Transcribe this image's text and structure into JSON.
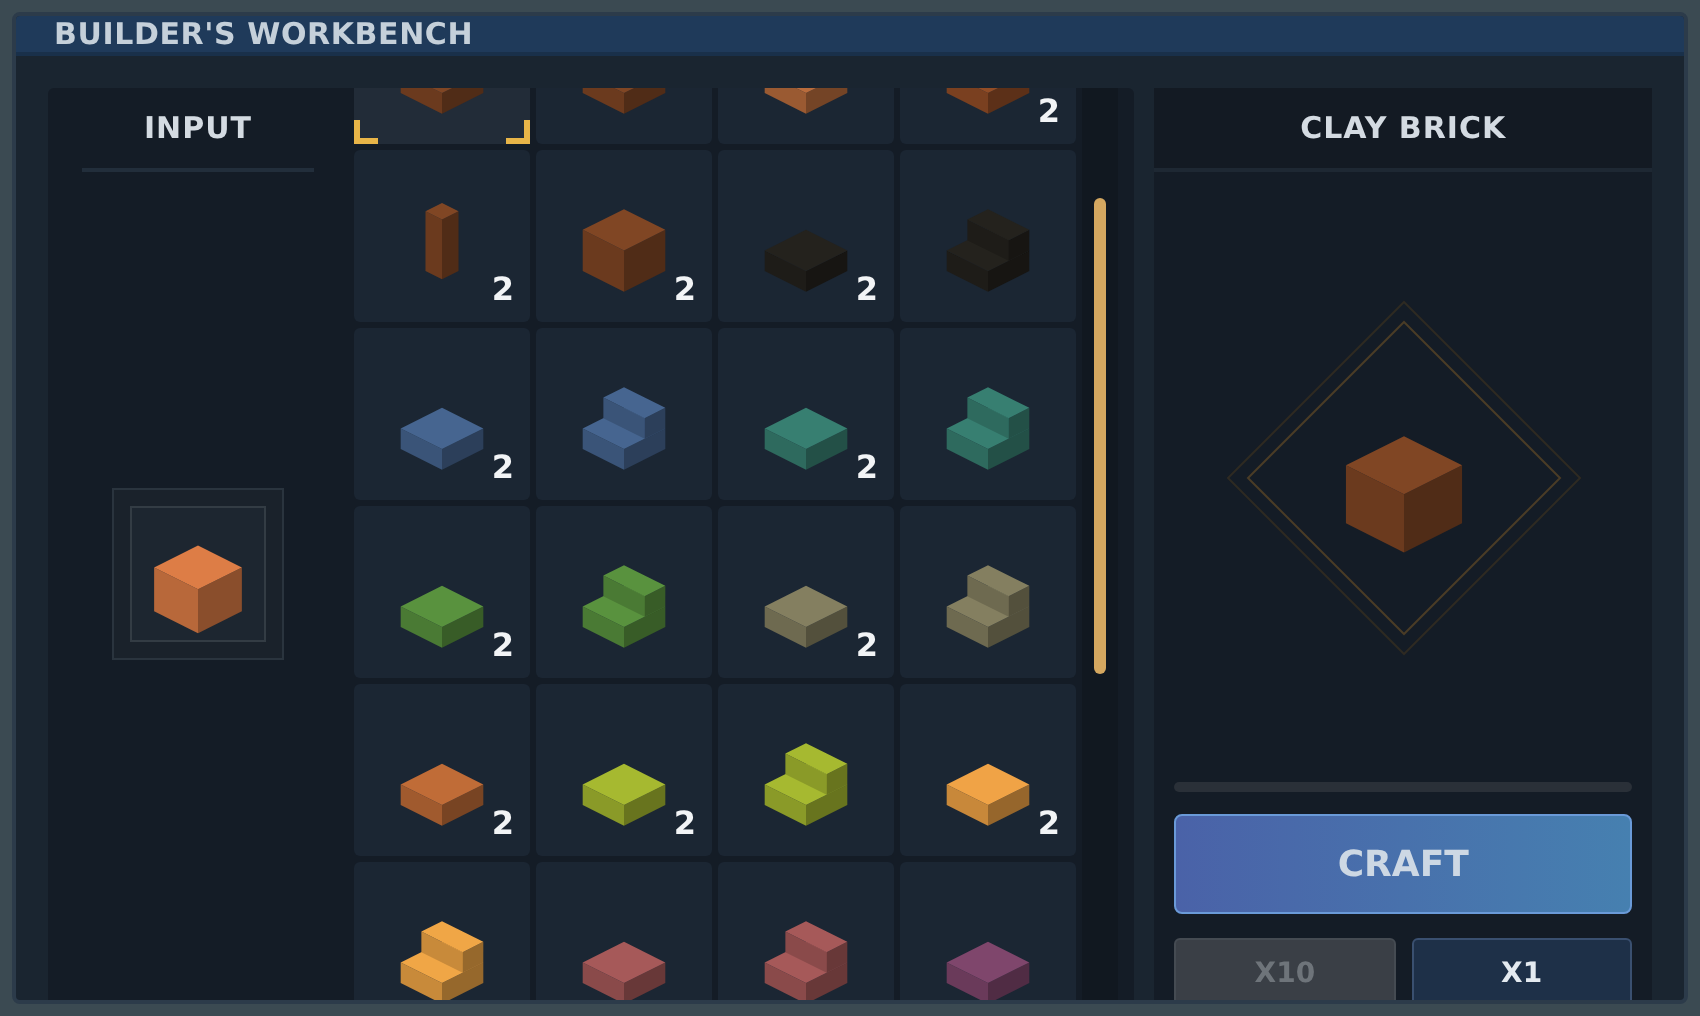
{
  "window": {
    "title": "BUILDER'S WORKBENCH"
  },
  "input": {
    "label": "INPUT",
    "item": {
      "kind": "cube",
      "color": "#b8683a"
    }
  },
  "recipes": [
    {
      "kind": "slab",
      "color": "#6b3a1e",
      "selected": true
    },
    {
      "kind": "slab",
      "color": "#6b3a1e",
      "selected": false
    },
    {
      "kind": "slab",
      "color": "#9a5a32",
      "selected": false
    },
    {
      "kind": "slab",
      "color": "#7a4020",
      "count": "2",
      "selected": false
    },
    {
      "kind": "pillar",
      "color": "#6b3a1e",
      "count": "2",
      "selected": false
    },
    {
      "kind": "cube",
      "color": "#6b3a1e",
      "count": "2",
      "selected": false
    },
    {
      "kind": "slab",
      "color": "#1e1c18",
      "count": "2",
      "selected": false
    },
    {
      "kind": "stairs",
      "color": "#1e1c18",
      "selected": false
    },
    {
      "kind": "slab",
      "color": "#3a5478",
      "count": "2",
      "selected": false
    },
    {
      "kind": "stairs",
      "color": "#3a5478",
      "selected": false
    },
    {
      "kind": "slab",
      "color": "#2e6a5e",
      "count": "2",
      "selected": false
    },
    {
      "kind": "stairs",
      "color": "#2e6a5e",
      "selected": false
    },
    {
      "kind": "slab",
      "color": "#4a7a34",
      "count": "2",
      "selected": false
    },
    {
      "kind": "stairs",
      "color": "#4a7a34",
      "selected": false
    },
    {
      "kind": "slab",
      "color": "#6e6a50",
      "count": "2",
      "selected": false
    },
    {
      "kind": "stairs",
      "color": "#6e6a50",
      "selected": false
    },
    {
      "kind": "slab",
      "color": "#a05a2e",
      "count": "2",
      "selected": false
    },
    {
      "kind": "slab",
      "color": "#8a9a28",
      "count": "2",
      "selected": false
    },
    {
      "kind": "stairs",
      "color": "#8a9a28",
      "selected": false
    },
    {
      "kind": "slab",
      "color": "#c8883a",
      "count": "2",
      "selected": false
    },
    {
      "kind": "stairs",
      "color": "#c88a3a",
      "selected": false
    },
    {
      "kind": "slab",
      "color": "#8a4a4a",
      "selected": false
    },
    {
      "kind": "stairs",
      "color": "#8a4a4a",
      "selected": false
    },
    {
      "kind": "slab",
      "color": "#6a3a5a",
      "selected": false
    }
  ],
  "output": {
    "title": "CLAY BRICK",
    "item": {
      "kind": "cube",
      "color": "#6b3a1e"
    },
    "craft_button": "CRAFT",
    "quantities": [
      {
        "label": "X10",
        "selected": false
      },
      {
        "label": "X1",
        "selected": true
      }
    ]
  }
}
